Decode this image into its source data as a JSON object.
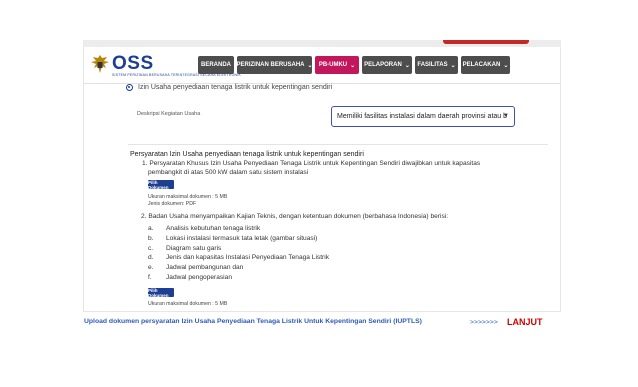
{
  "header": {
    "logo_text": "OSS",
    "logo_tagline": "SISTEM PERIZINAN BERUSAHA TERINTEGRASI SECARA ELEKTRONIK",
    "menus": [
      {
        "label": "BERANDA",
        "has_dropdown": false
      },
      {
        "label": "PERIZINAN BERUSAHA",
        "has_dropdown": true
      },
      {
        "label": "PB-UMKU",
        "has_dropdown": true,
        "active": true
      },
      {
        "label": "PELAPORAN",
        "has_dropdown": true
      },
      {
        "label": "FASILITAS",
        "has_dropdown": true
      },
      {
        "label": "PELACAKAN",
        "has_dropdown": true
      }
    ]
  },
  "form": {
    "radio_label": "Izin Usaha penyediaan tenaga listrik untuk kepentingan sendiri",
    "desc_label": "Deskripsi Kegiatan Usaha",
    "desc_value": "Memiliki fasilitas instalasi dalam daerah provinsi atau b",
    "req_title": "Persyaratan Izin Usaha penyediaan tenaga listrik untuk kepentingan sendiri",
    "req1_line1": "1. Persyaratan Khusus Izin Usaha Penyediaan Tenaga Listrik untuk Kepentingan Sendiri diwajibkan untuk kapasitas",
    "req1_line2": "pembangkit di atas 500 kW dalam satu sistem instalasi",
    "pilih_label": "Pilih Dokumen",
    "max_size": "Ukuran maksimal dokumen : 5 MB",
    "doc_type": "Jenis dokumen: PDF",
    "req2_title": "2. Badan Usaha menyampaikan Kajian Teknis, dengan ketentuan dokumen (berbahasa Indonesia) berisi:",
    "req2_items": [
      {
        "letter": "a.",
        "text": "Analisis kebutuhan tenaga listrik"
      },
      {
        "letter": "b.",
        "text": "Lokasi instalasi termasuk tata letak (gambar situasi)"
      },
      {
        "letter": "c.",
        "text": "Diagram satu garis"
      },
      {
        "letter": "d.",
        "text": "Jenis dan kapasitas Instalasi Penyediaan Tenaga Listrik"
      },
      {
        "letter": "e.",
        "text": "Jadwal pembangunan dan"
      },
      {
        "letter": "f.",
        "text": "Jadwal pengoperasian"
      }
    ],
    "pilih_label_2": "Pilih Dokumen",
    "max_size_2": "Ukuran maksimal dokumen : 5 MB"
  },
  "footer": {
    "caption": "Upload dokumen persyaratan Izin Usaha Penyediaan Tenaga Listrik Untuk Kepentingan Sendiri (IUPTLS)",
    "arrows": ">>>>>>>",
    "next": "LANJUT"
  },
  "colors": {
    "brand_blue": "#1c3f94",
    "menu_gray": "#4d4d4d",
    "menu_active": "#c2185b",
    "caption_blue": "#2e5bb8",
    "lanjut_red": "#d00000"
  }
}
